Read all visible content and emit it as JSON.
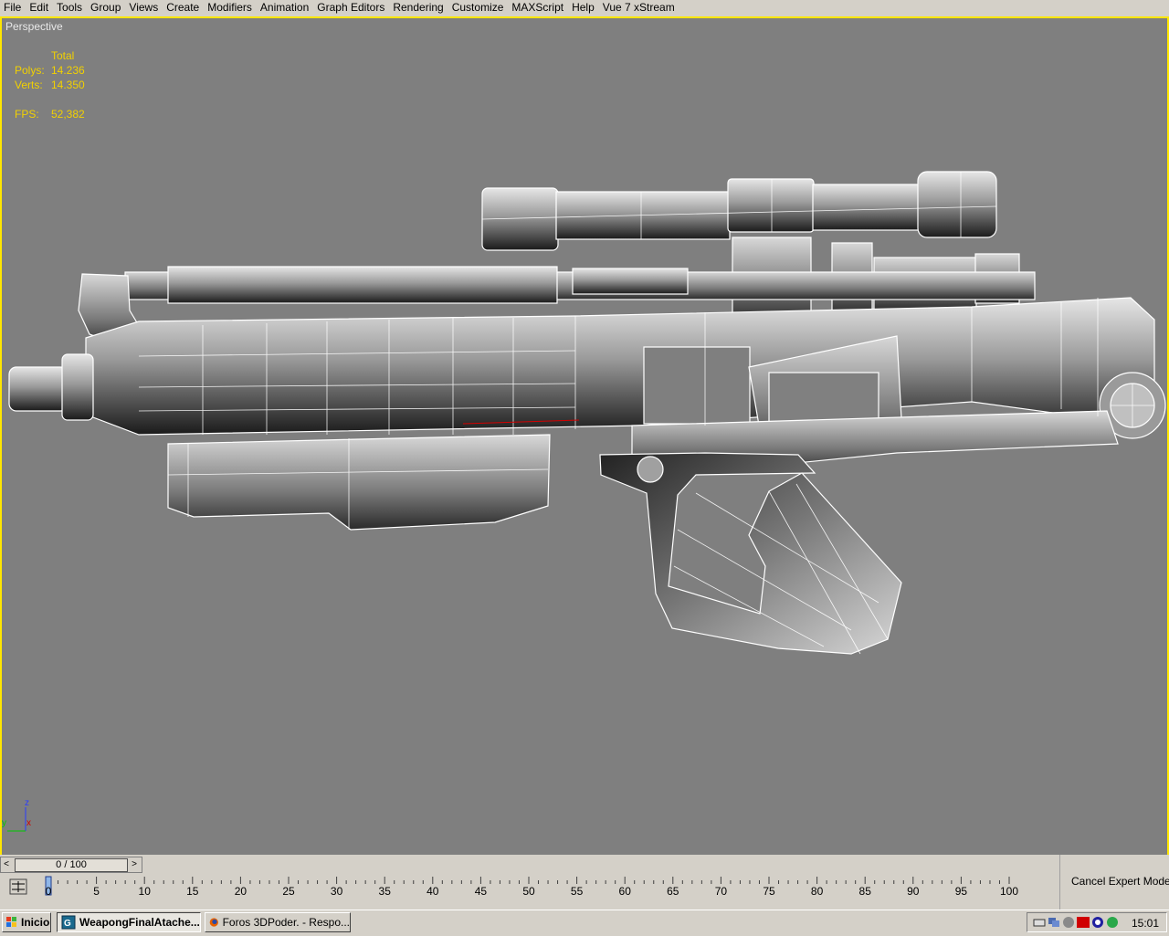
{
  "menubar": {
    "items": [
      "File",
      "Edit",
      "Tools",
      "Group",
      "Views",
      "Create",
      "Modifiers",
      "Animation",
      "Graph Editors",
      "Rendering",
      "Customize",
      "MAXScript",
      "Help",
      "Vue 7 xStream"
    ]
  },
  "viewport": {
    "label": "Perspective",
    "stats": {
      "total_label": "Total",
      "polys_label": "Polys:",
      "polys_value": "14.236",
      "verts_label": "Verts:",
      "verts_value": "14.350",
      "fps_label": "FPS:",
      "fps_value": "52,382"
    },
    "axis": {
      "z": "z",
      "y": "y",
      "x": "x"
    },
    "border_color": "#ffe600",
    "background": "#7f7f7f"
  },
  "timeline": {
    "slider_text": "0 / 100",
    "prev_arrow": "<",
    "next_arrow": ">",
    "ticks": [
      "0",
      "5",
      "10",
      "15",
      "20",
      "25",
      "30",
      "35",
      "40",
      "45",
      "50",
      "55",
      "60",
      "65",
      "70",
      "75",
      "80",
      "85",
      "90",
      "95",
      "100"
    ]
  },
  "expert": {
    "cancel_label": "Cancel Expert Mode"
  },
  "taskbar": {
    "start_label": "Inicio",
    "tasks": [
      {
        "label": "WeapongFinalAtache...",
        "icon": "3dsmax-icon"
      },
      {
        "label": "Foros 3DPoder. - Respo...",
        "icon": "firefox-icon"
      }
    ],
    "clock": "15:01"
  }
}
